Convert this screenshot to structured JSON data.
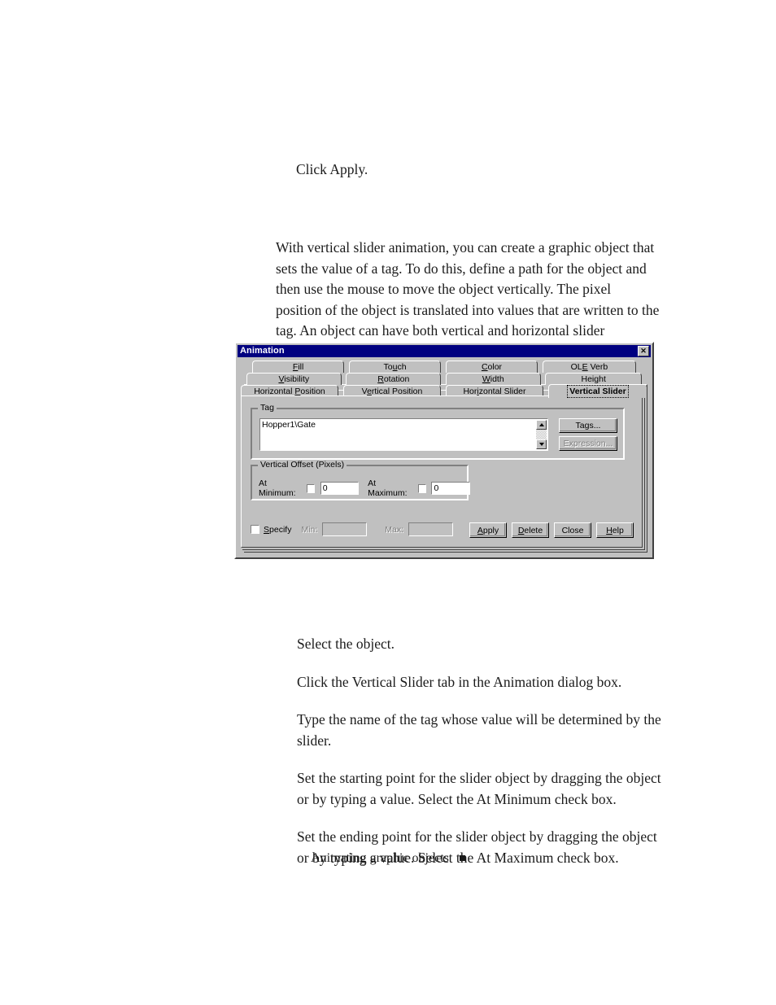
{
  "document": {
    "intro_step": "Click Apply.",
    "description": "With vertical slider animation, you can create a graphic object that sets the value of a tag. To do this, define a path for the object and then use the mouse to move the object vertically. The pixel position of the object is translated into values that are written to the tag. An object can have both vertical and horizontal slider animation.",
    "steps": [
      "Select the object.",
      "Click the Vertical Slider tab in the Animation dialog box.",
      "Type the name of the tag whose value will be determined by the slider.",
      "Set the starting point for the slider object by dragging the object or by typing a value. Select the At Minimum check box.",
      "Set the ending point for the slider object by dragging the object or by typing a value. Select the At Maximum check box."
    ],
    "footer": {
      "text": "Animating graphic objects",
      "marker": "■"
    }
  },
  "dialog": {
    "title": "Animation",
    "close_label": "✕",
    "colors": {
      "titlebar": "#000080",
      "face": "#c0c0c0",
      "shadow": "#808080",
      "field": "#ffffff"
    },
    "tab_rows": [
      [
        {
          "label": "Fill",
          "accel": "F",
          "selected": false
        },
        {
          "label": "Touch",
          "accel": "u",
          "selected": false
        },
        {
          "label": "Color",
          "accel": "C",
          "selected": false
        },
        {
          "label": "OLE Verb",
          "accel": "E",
          "selected": false
        }
      ],
      [
        {
          "label": "Visibility",
          "accel": "V",
          "selected": false
        },
        {
          "label": "Rotation",
          "accel": "R",
          "selected": false
        },
        {
          "label": "Width",
          "accel": "W",
          "selected": false
        },
        {
          "label": "Height",
          "accel": "g",
          "selected": false
        }
      ],
      [
        {
          "label": "Horizontal Position",
          "accel": "P",
          "selected": false
        },
        {
          "label": "Vertical Position",
          "accel": "e",
          "selected": false
        },
        {
          "label": "Horizontal Slider",
          "accel": "i",
          "selected": false
        },
        {
          "label": "Vertical Slider",
          "accel": "",
          "selected": true
        }
      ]
    ],
    "tag_group": {
      "title": "Tag",
      "value": "Hopper1\\Gate",
      "tags_button": "Tags...",
      "expression_button": "Expression...",
      "expression_enabled": false
    },
    "offset_group": {
      "title": "Vertical Offset (Pixels)",
      "at_minimum_label": "At Minimum:",
      "at_minimum_checked": false,
      "at_minimum_value": "0",
      "at_maximum_label": "At Maximum:",
      "at_maximum_checked": false,
      "at_maximum_value": "0"
    },
    "bottom": {
      "specify_label": "Specify",
      "specify_accel": "S",
      "specify_checked": false,
      "min_label": "Min:",
      "min_value": "",
      "max_label": "Max:",
      "max_value": "",
      "fields_enabled": false,
      "buttons": [
        {
          "label": "Apply",
          "accel": "A"
        },
        {
          "label": "Delete",
          "accel": "D"
        },
        {
          "label": "Close",
          "accel": ""
        },
        {
          "label": "Help",
          "accel": "H"
        }
      ]
    }
  }
}
